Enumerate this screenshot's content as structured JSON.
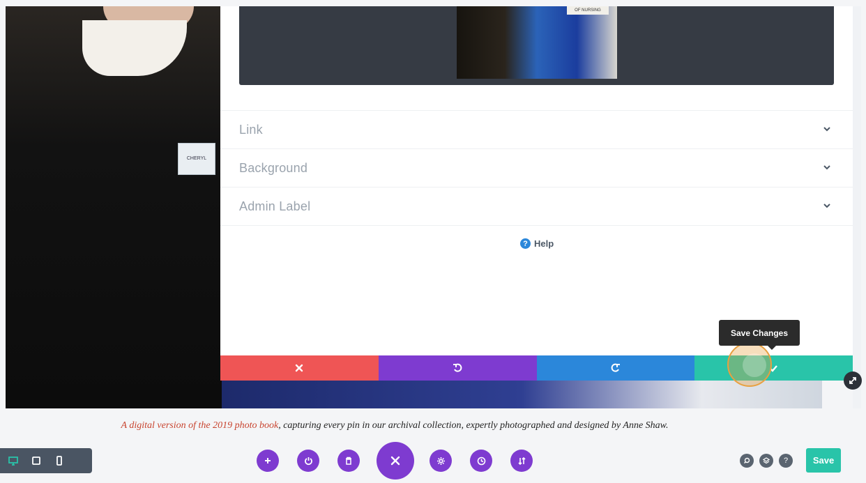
{
  "modal": {
    "toggles": [
      {
        "label": "Link"
      },
      {
        "label": "Background"
      },
      {
        "label": "Admin Label"
      }
    ],
    "help_label": "Help"
  },
  "tooltip": {
    "text": "Save Changes"
  },
  "actionbar": {
    "cancel_icon": "close-icon",
    "undo_icon": "undo-icon",
    "redo_icon": "redo-icon",
    "save_icon": "check-icon"
  },
  "photo": {
    "badge_text": "CHERYL",
    "sign_text": "OF NURSING"
  },
  "caption": {
    "highlight": "A digital version of the 2019 photo book",
    "rest": ", capturing every pin in our archival collection, expertly photographed and designed by Anne Shaw."
  },
  "bottombar": {
    "save_label": "Save",
    "view_modes": [
      "desktop-icon",
      "tablet-icon",
      "phone-icon"
    ],
    "tools": [
      "plus-icon",
      "power-icon",
      "trash-icon",
      "close-icon",
      "gear-icon",
      "history-icon",
      "sort-icon"
    ],
    "right_tools": [
      "search-icon",
      "layers-icon",
      "help-icon"
    ],
    "help_glyph": "?"
  },
  "colors": {
    "purple": "#7e3bd0",
    "red": "#ef5555",
    "blue": "#2b87da",
    "teal": "#29c4a9",
    "dark": "#363b44"
  }
}
